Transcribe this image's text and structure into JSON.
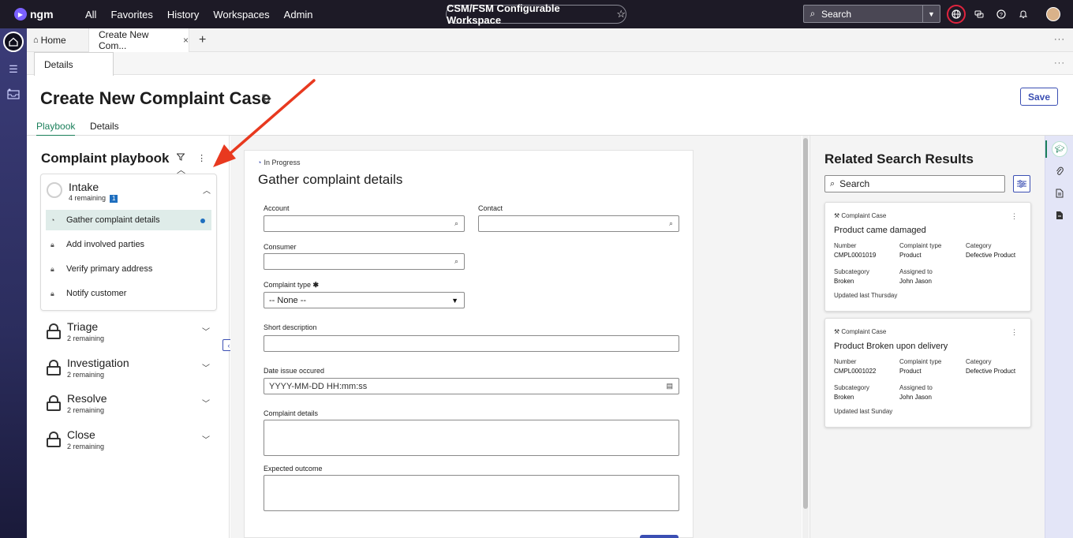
{
  "topnav": {
    "logo_text": "ngm",
    "menu": [
      "All",
      "Favorites",
      "History",
      "Workspaces",
      "Admin"
    ],
    "workspace": "CSM/FSM Configurable Workspace",
    "search_placeholder": "Search",
    "icons": [
      "globe-icon",
      "chat-icon",
      "help-icon",
      "bell-icon"
    ]
  },
  "tabs": {
    "home_label": "Home",
    "active_label": "Create New Com...",
    "close_glyph": "×",
    "plus_glyph": "+"
  },
  "subtab": {
    "label": "Details"
  },
  "header": {
    "title": "Create New Complaint Case",
    "save_label": "Save"
  },
  "pagetabs": [
    "Playbook",
    "Details"
  ],
  "playbook": {
    "title": "Complaint playbook",
    "active_stage": {
      "name": "Intake",
      "remaining": "4 remaining",
      "badge": "1",
      "steps": [
        {
          "label": "Gather complaint details",
          "state": "active"
        },
        {
          "label": "Add involved parties",
          "state": "locked"
        },
        {
          "label": "Verify primary address",
          "state": "locked"
        },
        {
          "label": "Notify customer",
          "state": "locked"
        }
      ]
    },
    "stages": [
      {
        "name": "Triage",
        "remaining": "2 remaining"
      },
      {
        "name": "Investigation",
        "remaining": "2 remaining"
      },
      {
        "name": "Resolve",
        "remaining": "2 remaining"
      },
      {
        "name": "Close",
        "remaining": "2 remaining"
      }
    ]
  },
  "form": {
    "status": "In Progress",
    "title": "Gather complaint details",
    "labels": {
      "account": "Account",
      "contact": "Contact",
      "consumer": "Consumer",
      "complaint_type": "Complaint type",
      "short_description": "Short description",
      "date_issue": "Date issue occured",
      "complaint_details": "Complaint details",
      "expected_outcome": "Expected outcome"
    },
    "complaint_type_value": "-- None --",
    "date_placeholder": "YYYY-MM-DD HH:mm:ss"
  },
  "related": {
    "title": "Related Search Results",
    "search_placeholder": "Search",
    "cards": [
      {
        "kind": "Complaint Case",
        "title": "Product came damaged",
        "number_label": "Number",
        "number": "CMPL0001019",
        "type_label": "Complaint type",
        "type": "Product",
        "category_label": "Category",
        "category": "Defective Product",
        "subcategory_label": "Subcategory",
        "subcategory": "Broken",
        "assigned_label": "Assigned to",
        "assigned": "John Jason",
        "updated": "Updated last Thursday"
      },
      {
        "kind": "Complaint Case",
        "title": "Product Broken upon delivery",
        "number_label": "Number",
        "number": "CMPL0001022",
        "type_label": "Complaint type",
        "type": "Product",
        "category_label": "Category",
        "category": "Defective Product",
        "subcategory_label": "Subcategory",
        "subcategory": "Broken",
        "assigned_label": "Assigned to",
        "assigned": "John Jason",
        "updated": "Updated last Sunday"
      }
    ]
  },
  "colors": {
    "topbar": "#1d1a26",
    "accent": "#3b4fb3",
    "active_tab": "#1a7f5a",
    "annotation_arrow": "#e8391f"
  }
}
